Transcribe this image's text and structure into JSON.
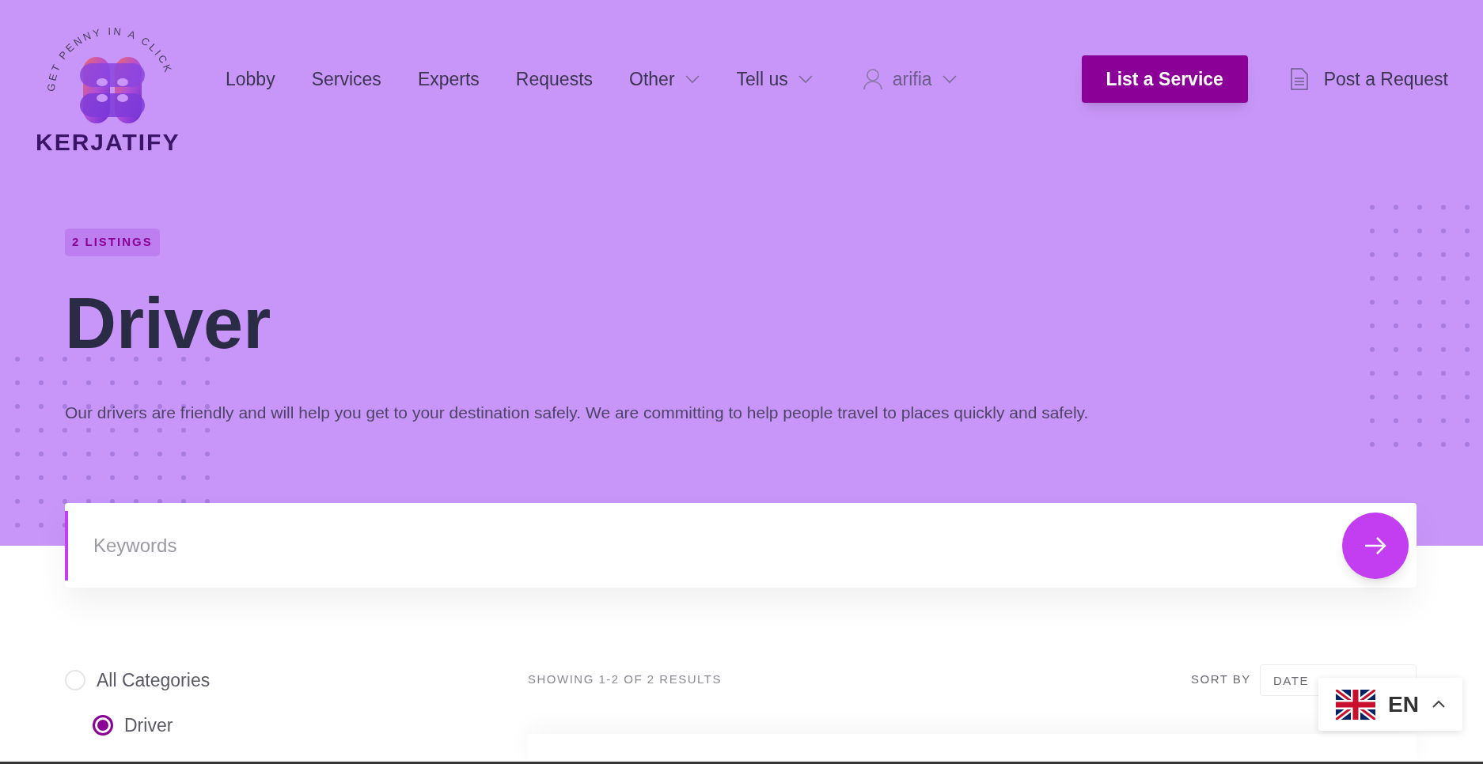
{
  "logo": {
    "tagline": "GET PENNY IN A CLICK",
    "name": "KERJATIFY"
  },
  "nav": [
    {
      "label": "Lobby",
      "dropdown": false
    },
    {
      "label": "Services",
      "dropdown": false
    },
    {
      "label": "Experts",
      "dropdown": false
    },
    {
      "label": "Requests",
      "dropdown": false
    },
    {
      "label": "Other",
      "dropdown": true
    },
    {
      "label": "Tell us",
      "dropdown": true
    }
  ],
  "user": {
    "name": "arifia"
  },
  "actions": {
    "primary": "List a Service",
    "secondary": "Post a Request"
  },
  "hero": {
    "badge": "2 LISTINGS",
    "title": "Driver",
    "description": "Our drivers are friendly and will help you get to your destination safely. We are committing to help people travel to places quickly and safely."
  },
  "search": {
    "placeholder": "Keywords"
  },
  "categories": [
    {
      "label": "All Categories",
      "selected": false,
      "children": [
        {
          "label": "Driver",
          "selected": true
        }
      ]
    }
  ],
  "results": {
    "summary": "SHOWING 1-2 OF 2 RESULTS",
    "sort_label": "SORT BY",
    "sort_value": "DATE"
  },
  "language": {
    "code": "EN"
  }
}
